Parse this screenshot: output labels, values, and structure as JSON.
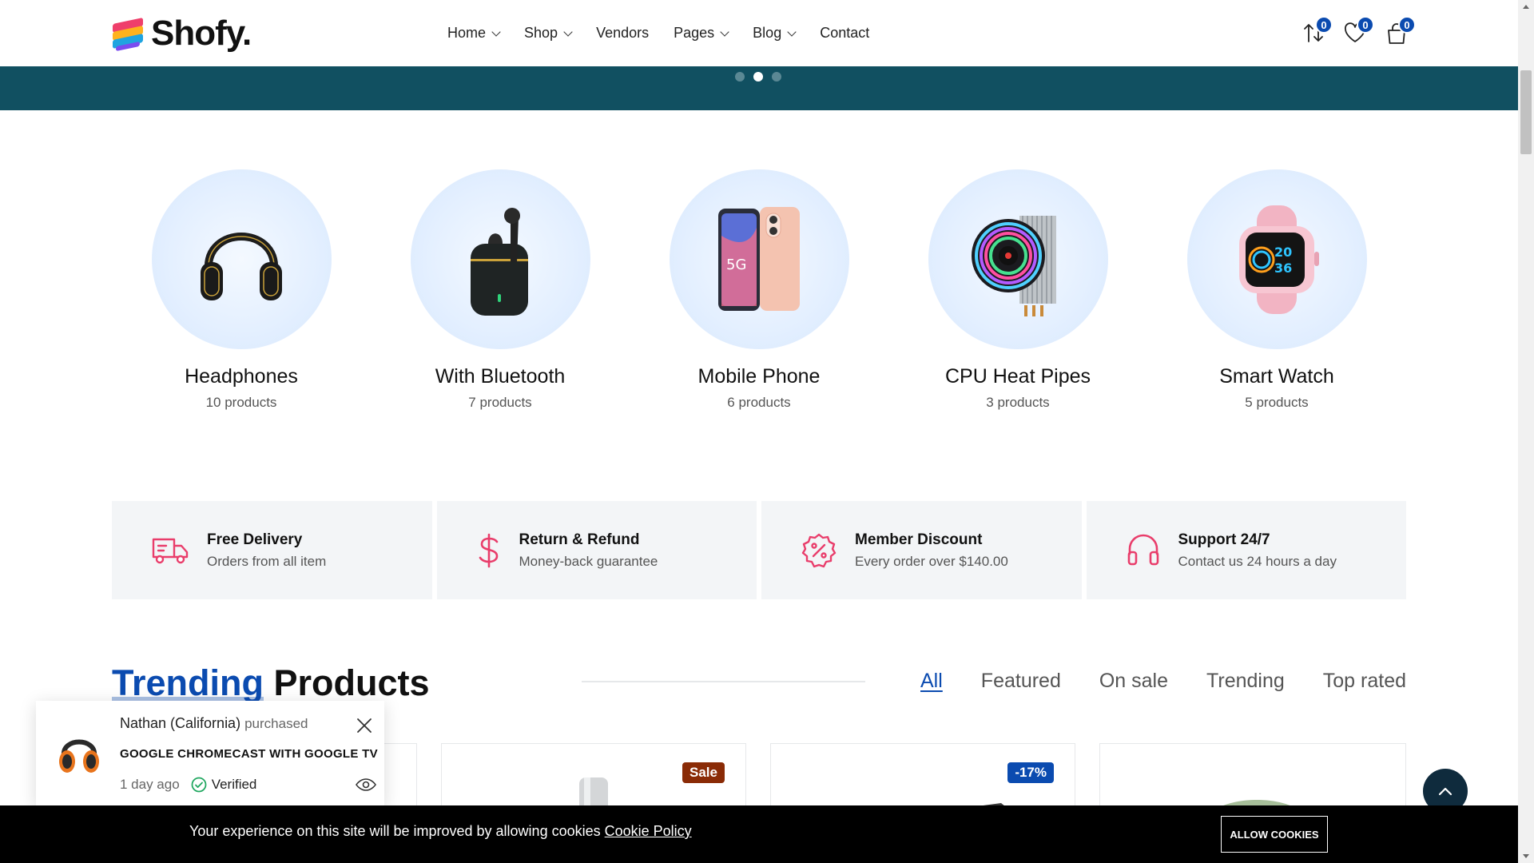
{
  "brand": {
    "name": "Shofy."
  },
  "nav": [
    {
      "label": "Home",
      "dropdown": true
    },
    {
      "label": "Shop",
      "dropdown": true
    },
    {
      "label": "Vendors",
      "dropdown": false
    },
    {
      "label": "Pages",
      "dropdown": true
    },
    {
      "label": "Blog",
      "dropdown": true
    },
    {
      "label": "Contact",
      "dropdown": false
    }
  ],
  "header_actions": {
    "compare_count": "0",
    "wishlist_count": "0",
    "cart_count": "0"
  },
  "hero": {
    "slide_count": 3,
    "active_slide": 2
  },
  "categories": [
    {
      "name": "Headphones",
      "count": "10 products",
      "icon": "headphones-icon"
    },
    {
      "name": "With Bluetooth",
      "count": "7 products",
      "icon": "earbuds-icon"
    },
    {
      "name": "Mobile Phone",
      "count": "6 products",
      "icon": "phone-icon"
    },
    {
      "name": "CPU Heat Pipes",
      "count": "3 products",
      "icon": "cpu-cooler-icon"
    },
    {
      "name": "Smart Watch",
      "count": "5 products",
      "icon": "smartwatch-icon"
    }
  ],
  "features": [
    {
      "title": "Free Delivery",
      "subtitle": "Orders from all item",
      "icon": "truck-icon"
    },
    {
      "title": "Return & Refund",
      "subtitle": "Money-back guarantee",
      "icon": "dollar-icon"
    },
    {
      "title": "Member Discount",
      "subtitle": "Every order over $140.00",
      "icon": "discount-icon"
    },
    {
      "title": "Support 24/7",
      "subtitle": "Contact us 24 hours a day",
      "icon": "headset-icon"
    }
  ],
  "trending": {
    "title_accent": "Trending",
    "title_rest": "Products",
    "tabs": [
      "All",
      "Featured",
      "On sale",
      "Trending",
      "Top rated"
    ],
    "active_tab": "All",
    "badges": {
      "sale": "Sale",
      "discount": "-17%"
    }
  },
  "popup": {
    "buyer": "Nathan (California)",
    "action": "purchased",
    "product": "GOOGLE CHROMECAST WITH GOOGLE TV",
    "time": "1 day ago",
    "verified": "Verified"
  },
  "cookie": {
    "text": "Your experience on this site will be improved by allowing cookies",
    "link": "Cookie Policy",
    "button": "ALLOW COOKIES"
  },
  "colors": {
    "accent": "#0b4bb0",
    "hero_bg": "#115061",
    "feature_icon": "#e93d6b",
    "sale_badge": "#8a2b06",
    "discount_badge": "#0b4bb0"
  }
}
